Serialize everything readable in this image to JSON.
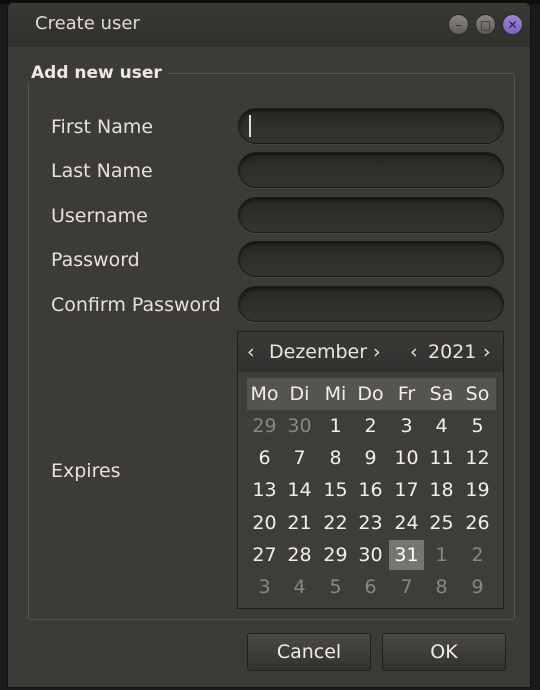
{
  "window": {
    "title": "Create user",
    "controls": {
      "minimize": "minimize-icon",
      "maximize": "maximize-icon",
      "close": "close-icon"
    }
  },
  "group": {
    "title": "Add new user"
  },
  "form": {
    "first_name_label": "First Name",
    "last_name_label": "Last Name",
    "username_label": "Username",
    "password_label": "Password",
    "confirm_password_label": "Confirm Password",
    "expires_label": "Expires",
    "first_name_value": "",
    "last_name_value": "",
    "username_value": "",
    "password_value": "",
    "confirm_password_value": ""
  },
  "calendar": {
    "month": "Dezember",
    "year": "2021",
    "prev_month_glyph": "‹",
    "next_month_glyph": "›",
    "prev_year_glyph": "‹",
    "next_year_glyph": "›",
    "weekdays": [
      "Mo",
      "Di",
      "Mi",
      "Do",
      "Fr",
      "Sa",
      "So"
    ],
    "weeks": [
      [
        "29",
        "30",
        "1",
        "2",
        "3",
        "4",
        "5"
      ],
      [
        "6",
        "7",
        "8",
        "9",
        "10",
        "11",
        "12"
      ],
      [
        "13",
        "14",
        "15",
        "16",
        "17",
        "18",
        "19"
      ],
      [
        "20",
        "21",
        "22",
        "23",
        "24",
        "25",
        "26"
      ],
      [
        "27",
        "28",
        "29",
        "30",
        "31",
        "1",
        "2"
      ],
      [
        "3",
        "4",
        "5",
        "6",
        "7",
        "8",
        "9"
      ]
    ],
    "selected_day": "31"
  },
  "buttons": {
    "cancel": "Cancel",
    "ok": "OK"
  },
  "colors": {
    "close_button": "#8a6fcf",
    "selected_day": "#77756f"
  }
}
